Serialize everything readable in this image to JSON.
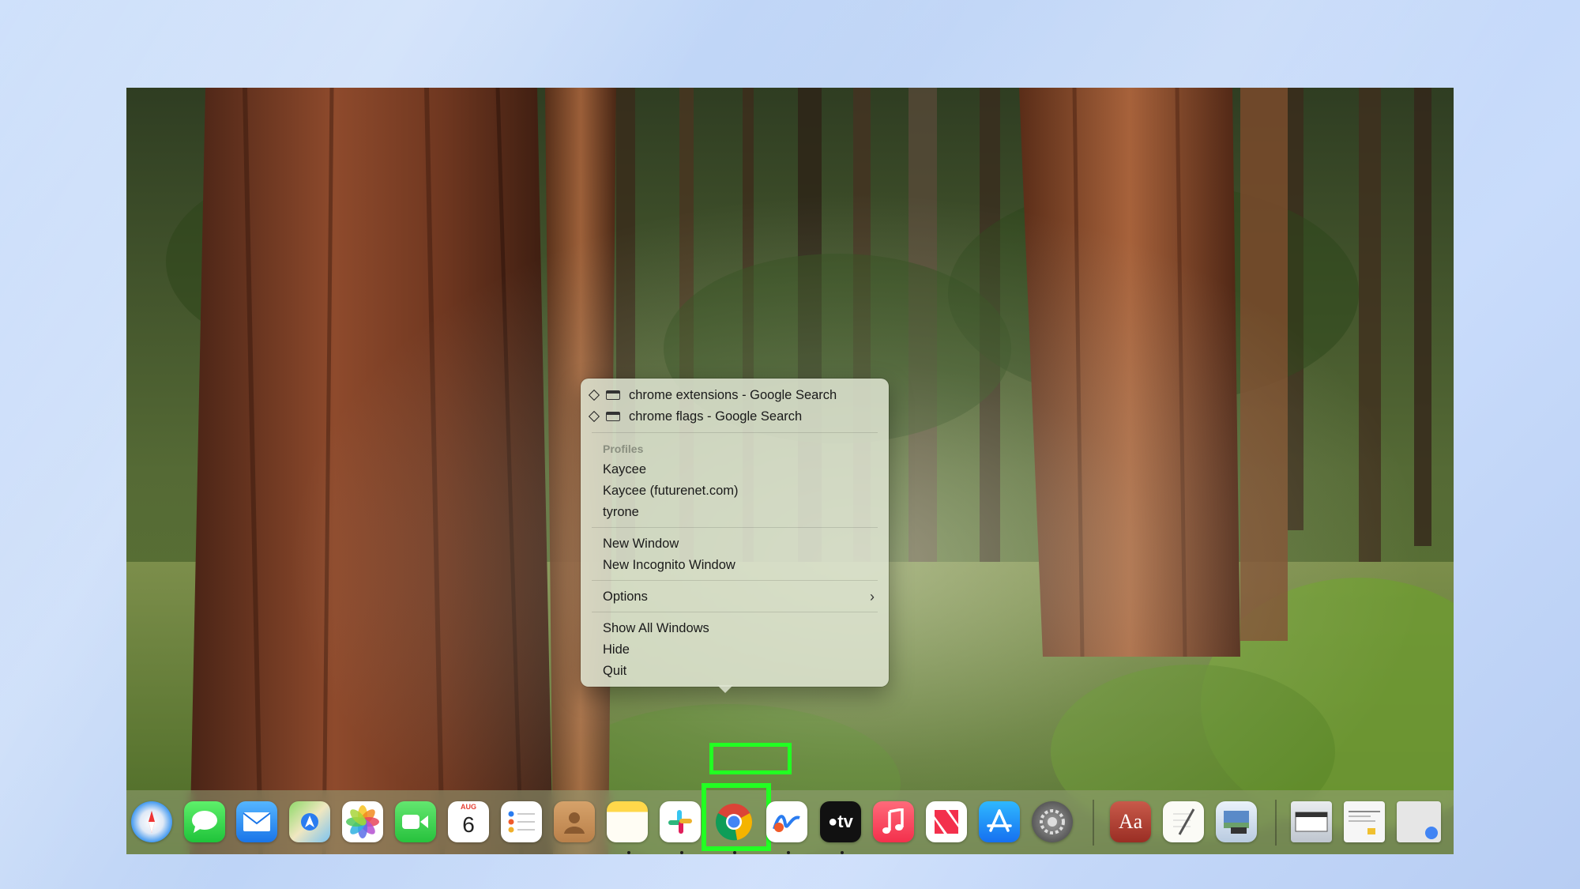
{
  "menu": {
    "windows": [
      "chrome extensions - Google Search",
      "chrome flags - Google Search"
    ],
    "profiles_header": "Profiles",
    "profiles": [
      "Kaycee",
      "Kaycee (futurenet.com)",
      "tyrone"
    ],
    "new_window": "New Window",
    "new_incognito": "New Incognito Window",
    "options": "Options",
    "show_all": "Show All Windows",
    "hide": "Hide",
    "quit": "Quit"
  },
  "dock": {
    "calendar_month": "AUG",
    "calendar_day": "6",
    "apple_tv_label": "tv",
    "dictionary_label": "Aa",
    "apps": [
      "safari-icon",
      "messages-icon",
      "mail-icon",
      "maps-icon",
      "photos-icon",
      "facetime-icon",
      "calendar-icon",
      "reminders-icon",
      "contacts-icon",
      "notes-icon",
      "slack-icon",
      "chrome-icon",
      "freeform-icon",
      "apple-tv-icon",
      "music-icon",
      "news-icon",
      "app-store-icon",
      "system-settings-icon",
      "dictionary-icon",
      "textedit-icon",
      "preview-icon",
      "window-thumb-1-icon",
      "window-thumb-2-icon",
      "window-thumb-3-icon"
    ]
  },
  "colors": {
    "highlight": "#22ff22",
    "dock_bg": "#969f78"
  }
}
